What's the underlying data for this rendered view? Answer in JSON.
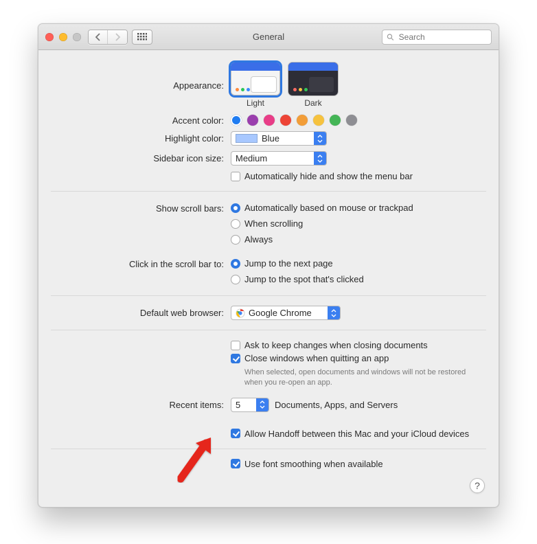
{
  "window": {
    "title": "General"
  },
  "search": {
    "placeholder": "Search"
  },
  "appearance": {
    "label": "Appearance:",
    "light": "Light",
    "dark": "Dark"
  },
  "accent": {
    "label": "Accent color:",
    "colors": [
      "#1f7cf1",
      "#9a3ead",
      "#e83d87",
      "#ed4436",
      "#f29d38",
      "#f6c23e",
      "#44b556",
      "#8e8e93"
    ],
    "selected_index": 0
  },
  "highlight": {
    "label": "Highlight color:",
    "value": "Blue"
  },
  "sidebar": {
    "label": "Sidebar icon size:",
    "value": "Medium"
  },
  "menubar_checkbox": "Automatically hide and show the menu bar",
  "scroll": {
    "label": "Show scroll bars:",
    "opt1": "Automatically based on mouse or trackpad",
    "opt2": "When scrolling",
    "opt3": "Always"
  },
  "click_scroll": {
    "label": "Click in the scroll bar to:",
    "opt1": "Jump to the next page",
    "opt2": "Jump to the spot that's clicked"
  },
  "browser": {
    "label": "Default web browser:",
    "value": "Google Chrome"
  },
  "docs": {
    "ask": "Ask to keep changes when closing documents",
    "close": "Close windows when quitting an app",
    "hint": "When selected, open documents and windows will not be restored when you re-open an app."
  },
  "recent": {
    "label": "Recent items:",
    "value": "5",
    "suffix": "Documents, Apps, and Servers"
  },
  "handoff": "Allow Handoff between this Mac and your iCloud devices",
  "smoothing": "Use font smoothing when available",
  "help": "?"
}
